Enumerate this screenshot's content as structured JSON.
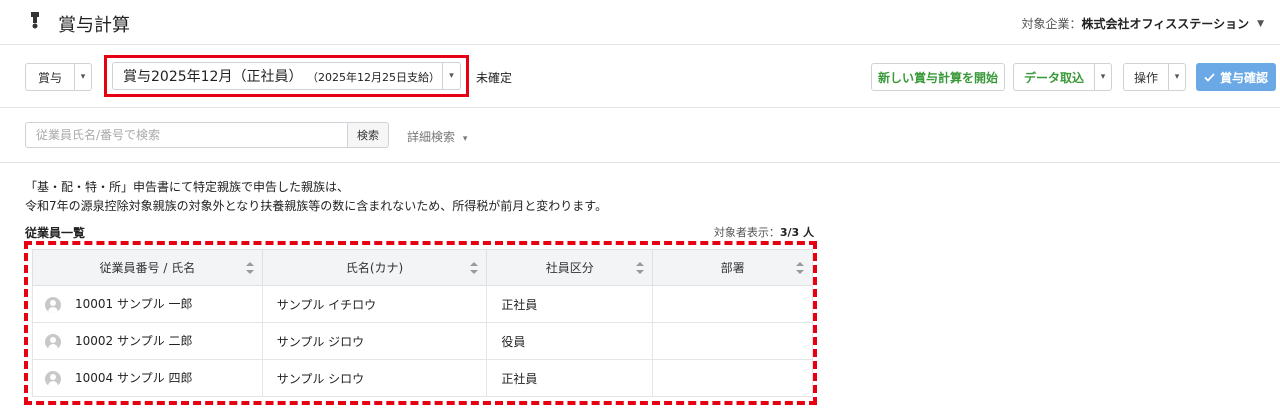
{
  "header": {
    "title": "賞与計算",
    "company_label": "対象企業：",
    "company_name": "株式会社オフィスステーション"
  },
  "toolbar": {
    "type_select": "賞与",
    "period_label": "賞与2025年12月（正社員）",
    "period_sub": "（2025年12月25日支給）",
    "status": "未確定",
    "new_calc_button": "新しい賞与計算を開始",
    "import_button": "データ取込",
    "operation_button": "操作",
    "confirm_button": "賞与確認"
  },
  "search": {
    "placeholder": "従業員氏名/番号で検索",
    "button": "検索",
    "advanced": "詳細検索"
  },
  "notice": {
    "line1": "「基・配・特・所」申告書にて特定親族で申告した親族は、",
    "line2": "令和7年の源泉控除対象親族の対象外となり扶養親族等の数に含まれないため、所得税が前月と変わります。"
  },
  "employee_list": {
    "title": "従業員一覧",
    "count_label": "対象者表示：",
    "count_value": "3/3 人",
    "columns": [
      "従業員番号 / 氏名",
      "氏名(カナ)",
      "社員区分",
      "部署"
    ],
    "rows": [
      {
        "id_name": "10001  サンプル 一郎",
        "kana": "サンプル イチロウ",
        "type": "正社員",
        "dept": ""
      },
      {
        "id_name": "10002  サンプル 二郎",
        "kana": "サンプル ジロウ",
        "type": "役員",
        "dept": ""
      },
      {
        "id_name": "10004  サンプル 四郎",
        "kana": "サンプル シロウ",
        "type": "正社員",
        "dept": ""
      }
    ]
  },
  "colors": {
    "highlight": "#e60012",
    "primary_button": "#6aa8e6",
    "green_text": "#3a9a3a"
  }
}
